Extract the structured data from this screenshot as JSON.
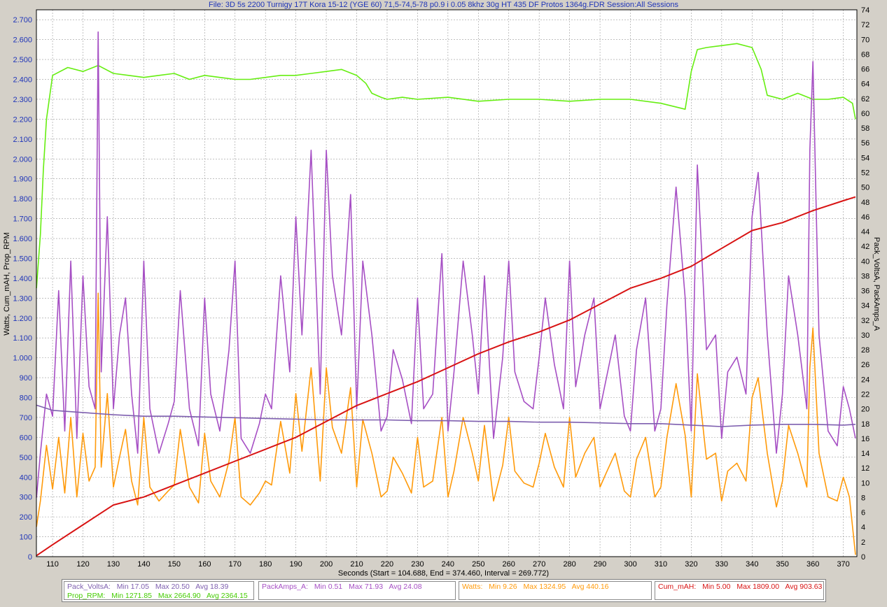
{
  "window": {
    "title": "File: 3D 5s 2200 Turnigy 17T Kora 15-12 (YGE 60) 71,5-74,5-78 p0.9 i 0.05 8khz 30g HT 435 DF Protos 1364g.FDR   Session:All Sessions"
  },
  "chart_data": {
    "type": "line",
    "title": "File: 3D 5s 2200 Turnigy 17T Kora 15-12 (YGE 60) 71,5-74,5-78 p0.9 i 0.05 8khz 30g HT 435 DF Protos 1364g.FDR   Session:All Sessions",
    "xlabel": "Seconds (Start = 104.688, End = 374.460, Interval = 269.772)",
    "ylabel_left": "Watts, Cum_mAH, Prop_RPM",
    "ylabel_right": "Pack_VoltsA, PackAmps_A",
    "xlim": [
      104.688,
      374.46
    ],
    "x_ticks": [
      110,
      120,
      130,
      140,
      150,
      160,
      170,
      180,
      190,
      200,
      210,
      220,
      230,
      240,
      250,
      260,
      270,
      280,
      290,
      300,
      310,
      320,
      330,
      340,
      350,
      360,
      370
    ],
    "y_left_lim": [
      0,
      2.75
    ],
    "y_left_ticks": [
      "0",
      "100",
      "200",
      "300",
      "400",
      "500",
      "600",
      "700",
      "800",
      "900",
      "1.000",
      "1.100",
      "1.200",
      "1.300",
      "1.400",
      "1.500",
      "1.600",
      "1.700",
      "1.800",
      "1.900",
      "2.000",
      "2.100",
      "2.200",
      "2.300",
      "2.400",
      "2.500",
      "2.600",
      "2.700"
    ],
    "y_right_lim": [
      0,
      74
    ],
    "y_right_ticks": [
      "0",
      "2",
      "4",
      "6",
      "8",
      "10",
      "12",
      "14",
      "16",
      "18",
      "20",
      "22",
      "24",
      "26",
      "28",
      "30",
      "32",
      "34",
      "36",
      "38",
      "40",
      "42",
      "44",
      "46",
      "48",
      "50",
      "52",
      "54",
      "56",
      "58",
      "60",
      "62",
      "64",
      "66",
      "68",
      "70",
      "72",
      "74"
    ],
    "grid": true,
    "legend_position": "bottom",
    "series": [
      {
        "name": "Prop_RPM",
        "axis": "left",
        "color": "#66ee11",
        "x": [
          104.7,
          106,
          107,
          108,
          110,
          115,
          120,
          125,
          130,
          135,
          140,
          145,
          150,
          155,
          160,
          165,
          170,
          175,
          180,
          185,
          190,
          195,
          200,
          205,
          210,
          213,
          215,
          218,
          220,
          225,
          230,
          240,
          250,
          260,
          270,
          280,
          290,
          300,
          310,
          318,
          320,
          322,
          325,
          330,
          335,
          340,
          343,
          345,
          350,
          355,
          360,
          365,
          370,
          373,
          374
        ],
        "y": [
          1.35,
          1.62,
          1.95,
          2.2,
          2.42,
          2.46,
          2.44,
          2.47,
          2.43,
          2.42,
          2.41,
          2.42,
          2.43,
          2.4,
          2.42,
          2.41,
          2.4,
          2.4,
          2.41,
          2.42,
          2.42,
          2.43,
          2.44,
          2.45,
          2.42,
          2.38,
          2.33,
          2.31,
          2.3,
          2.31,
          2.3,
          2.31,
          2.29,
          2.3,
          2.3,
          2.29,
          2.3,
          2.3,
          2.28,
          2.25,
          2.44,
          2.55,
          2.56,
          2.57,
          2.58,
          2.56,
          2.45,
          2.32,
          2.3,
          2.33,
          2.3,
          2.3,
          2.31,
          2.28,
          2.2
        ]
      },
      {
        "name": "PackAmps_A",
        "axis": "right",
        "color": "#a64fc4",
        "x": [
          104.7,
          106,
          108,
          110,
          112,
          114,
          116,
          118,
          120,
          122,
          124,
          125,
          126,
          128,
          130,
          132,
          134,
          136,
          138,
          140,
          142,
          145,
          148,
          150,
          152,
          155,
          158,
          160,
          162,
          165,
          168,
          170,
          172,
          175,
          178,
          180,
          182,
          185,
          188,
          190,
          192,
          195,
          198,
          200,
          202,
          205,
          208,
          210,
          212,
          215,
          218,
          220,
          222,
          225,
          228,
          230,
          232,
          235,
          238,
          240,
          242,
          245,
          248,
          250,
          252,
          255,
          258,
          260,
          262,
          265,
          268,
          270,
          272,
          275,
          278,
          280,
          282,
          285,
          288,
          290,
          292,
          295,
          298,
          300,
          302,
          305,
          308,
          310,
          312,
          315,
          318,
          320,
          322,
          325,
          328,
          330,
          332,
          335,
          338,
          340,
          342,
          345,
          348,
          350,
          352,
          355,
          358,
          359,
          360,
          362,
          365,
          368,
          370,
          372,
          374
        ],
        "y": [
          8,
          14,
          22,
          19,
          36,
          17,
          40,
          16,
          38,
          23,
          20,
          71,
          25,
          46,
          20,
          30,
          35,
          22,
          14,
          40,
          20,
          14,
          18,
          21,
          36,
          20,
          15,
          35,
          22,
          17,
          28,
          40,
          16,
          14,
          18,
          22,
          20,
          38,
          25,
          46,
          30,
          55,
          22,
          55,
          38,
          30,
          49,
          20,
          40,
          30,
          17,
          19,
          28,
          24,
          18,
          35,
          20,
          22,
          41,
          17,
          25,
          40,
          30,
          22,
          38,
          16,
          27,
          40,
          25,
          21,
          20,
          27,
          35,
          26,
          20,
          40,
          23,
          30,
          35,
          20,
          24,
          30,
          19,
          17,
          28,
          35,
          17,
          20,
          34,
          50,
          35,
          17,
          53,
          28,
          30,
          16,
          25,
          27,
          22,
          46,
          52,
          30,
          14,
          22,
          38,
          30,
          20,
          55,
          67,
          30,
          17,
          15,
          23,
          20,
          16
        ]
      },
      {
        "name": "Watts",
        "axis": "left",
        "color": "#ff9a0a",
        "x": [
          104.7,
          106,
          108,
          110,
          112,
          114,
          116,
          118,
          120,
          122,
          124,
          125,
          126,
          128,
          130,
          132,
          134,
          136,
          138,
          140,
          142,
          145,
          148,
          150,
          152,
          155,
          158,
          160,
          162,
          165,
          168,
          170,
          172,
          175,
          178,
          180,
          182,
          185,
          188,
          190,
          192,
          195,
          198,
          200,
          202,
          205,
          208,
          210,
          212,
          215,
          218,
          220,
          222,
          225,
          228,
          230,
          232,
          235,
          238,
          240,
          242,
          245,
          248,
          250,
          252,
          255,
          258,
          260,
          262,
          265,
          268,
          270,
          272,
          275,
          278,
          280,
          282,
          285,
          288,
          290,
          292,
          295,
          298,
          300,
          302,
          305,
          308,
          310,
          312,
          315,
          318,
          320,
          322,
          325,
          328,
          330,
          332,
          335,
          338,
          340,
          342,
          345,
          348,
          350,
          352,
          355,
          358,
          359,
          360,
          362,
          365,
          368,
          370,
          372,
          374
        ],
        "y": [
          150,
          280,
          560,
          340,
          600,
          320,
          700,
          300,
          620,
          380,
          450,
          1325,
          450,
          820,
          350,
          500,
          640,
          380,
          260,
          700,
          350,
          280,
          330,
          360,
          640,
          350,
          270,
          620,
          380,
          300,
          480,
          700,
          300,
          260,
          320,
          380,
          360,
          680,
          420,
          820,
          530,
          950,
          380,
          950,
          650,
          520,
          850,
          350,
          690,
          520,
          300,
          330,
          500,
          420,
          320,
          600,
          350,
          380,
          700,
          300,
          430,
          700,
          520,
          380,
          660,
          280,
          460,
          700,
          430,
          370,
          350,
          470,
          620,
          450,
          350,
          700,
          400,
          520,
          600,
          350,
          420,
          520,
          330,
          300,
          490,
          600,
          300,
          350,
          600,
          870,
          610,
          300,
          920,
          490,
          520,
          280,
          430,
          470,
          380,
          800,
          900,
          520,
          250,
          380,
          660,
          520,
          350,
          950,
          1150,
          520,
          300,
          280,
          400,
          300,
          9
        ]
      },
      {
        "name": "Pack_VoltsA",
        "axis": "right",
        "color": "#7e5faf",
        "x": [
          104.7,
          110,
          120,
          130,
          140,
          150,
          160,
          170,
          180,
          190,
          200,
          210,
          220,
          230,
          240,
          250,
          260,
          270,
          280,
          290,
          300,
          310,
          320,
          330,
          340,
          350,
          360,
          370,
          374
        ],
        "y": [
          20.5,
          19.8,
          19.5,
          19.2,
          19.0,
          19.0,
          18.9,
          18.8,
          18.7,
          18.6,
          18.5,
          18.5,
          18.5,
          18.4,
          18.4,
          18.3,
          18.3,
          18.2,
          18.2,
          18.1,
          18.0,
          18.0,
          17.8,
          17.6,
          17.8,
          17.9,
          17.9,
          17.8,
          17.9
        ]
      },
      {
        "name": "Cum_mAH",
        "axis": "left",
        "color": "#d81313",
        "x": [
          104.7,
          110,
          120,
          130,
          140,
          150,
          160,
          170,
          180,
          190,
          200,
          210,
          220,
          230,
          240,
          250,
          260,
          270,
          280,
          290,
          300,
          310,
          320,
          330,
          340,
          350,
          360,
          370,
          374
        ],
        "y": [
          5,
          60,
          160,
          260,
          300,
          360,
          420,
          480,
          540,
          600,
          680,
          760,
          820,
          880,
          950,
          1020,
          1080,
          1130,
          1190,
          1270,
          1350,
          1400,
          1460,
          1550,
          1640,
          1680,
          1740,
          1790,
          1809
        ]
      }
    ]
  },
  "legend": {
    "box1": {
      "row1": {
        "label": "Pack_VoltsA:",
        "min": "Min 17.05",
        "max": "Max 20.50",
        "avg": "Avg 18.39"
      },
      "row2": {
        "label": "Prop_RPM:",
        "min": "Min 1271.85",
        "max": "Max 2664.90",
        "avg": "Avg 2364.15"
      }
    },
    "box2": {
      "label": "PackAmps_A:",
      "min": "Min 0.51",
      "max": "Max 71.93",
      "avg": "Avg 24.08"
    },
    "box3": {
      "label": "Watts:",
      "min": "Min 9.26",
      "max": "Max 1324.95",
      "avg": "Avg 440.16"
    },
    "box4": {
      "label": "Cum_mAH:",
      "min": "Min 5.00",
      "max": "Max 1809.00",
      "avg": "Avg 903.63"
    },
    "colors": {
      "volts": "#7e5faf",
      "rpm": "#66ee11",
      "amps": "#a64fc4",
      "watts": "#ff9a0a",
      "mah": "#d81313"
    }
  }
}
